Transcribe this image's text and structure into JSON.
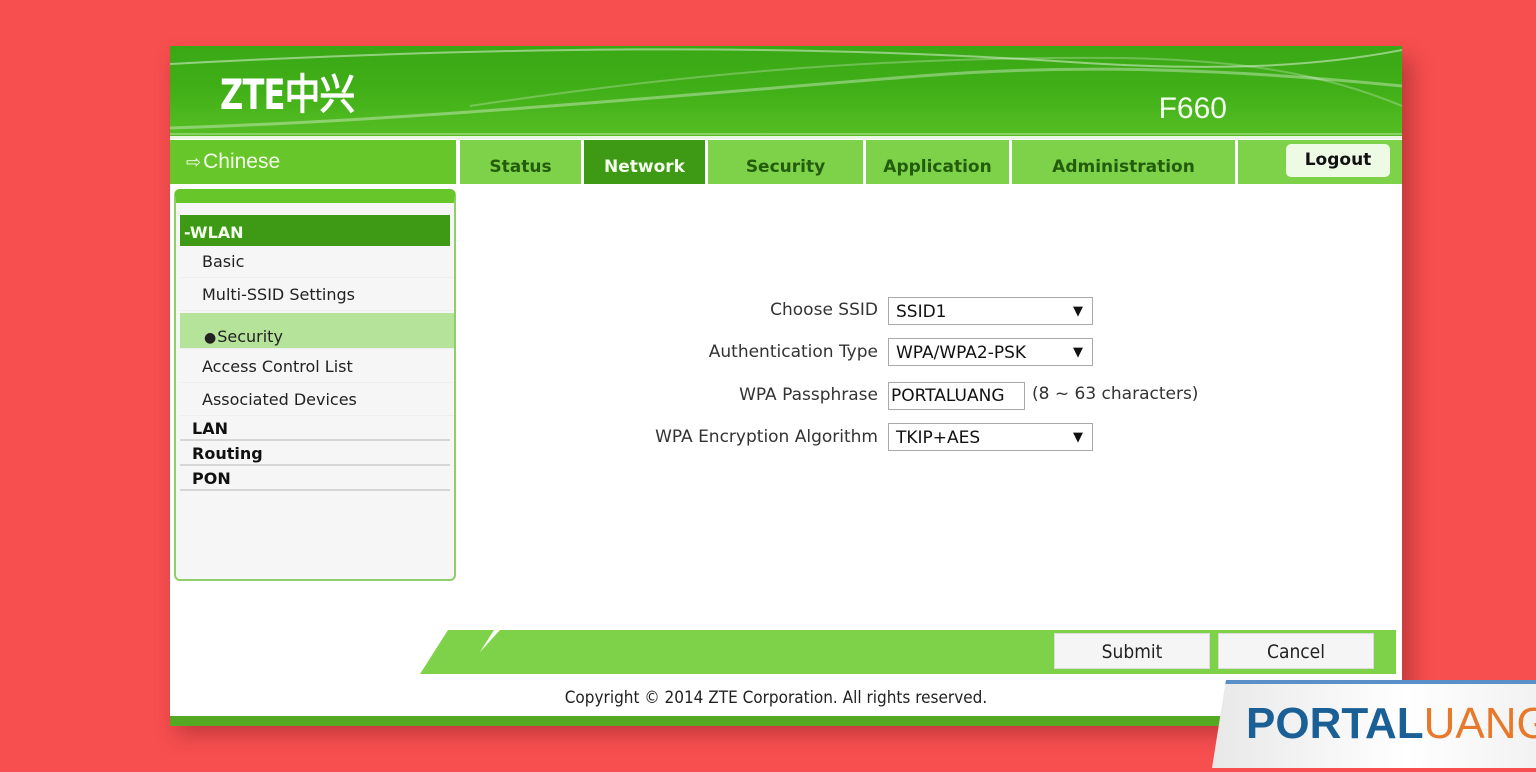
{
  "header": {
    "logo": "ZTE中兴",
    "model": "F660"
  },
  "language_link": {
    "icon": "arrow-right-outline-icon",
    "label": "Chinese"
  },
  "tabs": [
    {
      "label": "Status",
      "active": false
    },
    {
      "label": "Network",
      "active": true
    },
    {
      "label": "Security",
      "active": false
    },
    {
      "label": "Application",
      "active": false
    },
    {
      "label": "Administration",
      "active": false
    }
  ],
  "logout_label": "Logout",
  "sidebar": {
    "expanded_section": "-WLAN",
    "items": [
      {
        "label": "Basic",
        "active": false
      },
      {
        "label": "Multi-SSID Settings",
        "active": false
      },
      {
        "label": "Security",
        "active": true,
        "bullet": "●"
      },
      {
        "label": "Access Control List",
        "active": false
      },
      {
        "label": "Associated Devices",
        "active": false
      }
    ],
    "sections": [
      {
        "label": "LAN"
      },
      {
        "label": "Routing"
      },
      {
        "label": "PON"
      }
    ]
  },
  "form": {
    "ssid": {
      "label": "Choose SSID",
      "value": "SSID1"
    },
    "auth_type": {
      "label": "Authentication Type",
      "value": "WPA/WPA2-PSK"
    },
    "passphrase": {
      "label": "WPA Passphrase",
      "value": "PORTALUANG",
      "hint": "(8 ~ 63 characters)"
    },
    "encryption": {
      "label": "WPA Encryption Algorithm",
      "value": "TKIP+AES"
    },
    "caret": "▼"
  },
  "buttons": {
    "submit": "Submit",
    "cancel": "Cancel"
  },
  "copyright": "Copyright © 2014 ZTE Corporation. All rights reserved.",
  "watermark": {
    "part1": "PORTAL",
    "part2": "UANG"
  },
  "colors": {
    "background": "#f74e4f",
    "header_green": "#3fae17",
    "tab_green": "#7ed24a",
    "active_green": "#3e9a14",
    "sidebar_active": "#b5e39a"
  }
}
